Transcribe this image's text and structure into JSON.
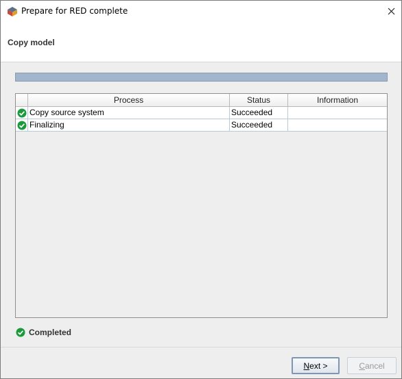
{
  "window": {
    "title": "Prepare for RED complete"
  },
  "header": {
    "title": "Copy model"
  },
  "progress": {
    "fraction": 1.0
  },
  "table": {
    "columns": [
      "Process",
      "Status",
      "Information"
    ],
    "rows": [
      {
        "process": "Copy source system",
        "status": "Succeeded",
        "information": ""
      },
      {
        "process": "Finalizing",
        "status": "Succeeded",
        "information": ""
      }
    ]
  },
  "status": {
    "label": "Completed"
  },
  "buttons": {
    "next": {
      "mnemonic": "N",
      "rest": "ext >"
    },
    "cancel": {
      "mnemonic": "C",
      "rest": "ancel"
    }
  },
  "colors": {
    "success_green": "#1a9a3a",
    "progress_fill": "#a1b5cc"
  }
}
